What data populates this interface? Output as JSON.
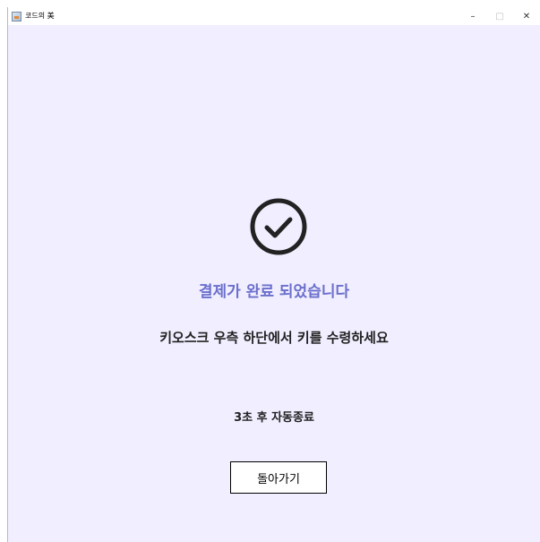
{
  "window": {
    "title": "코드의 美",
    "controls": {
      "minimize": "–",
      "maximize": "□",
      "close": "✕"
    }
  },
  "status_icon": "check-circle-icon",
  "message": {
    "headline": "결제가 완료 되었습니다",
    "instruction": "키오스크 우측 하단에서 키를 수령하세요",
    "countdown": "3초 후 자동종료"
  },
  "actions": {
    "back_label": "돌아가기"
  },
  "colors": {
    "background": "#f0eeff",
    "headline": "#6b6fcc",
    "icon": "#222222"
  }
}
